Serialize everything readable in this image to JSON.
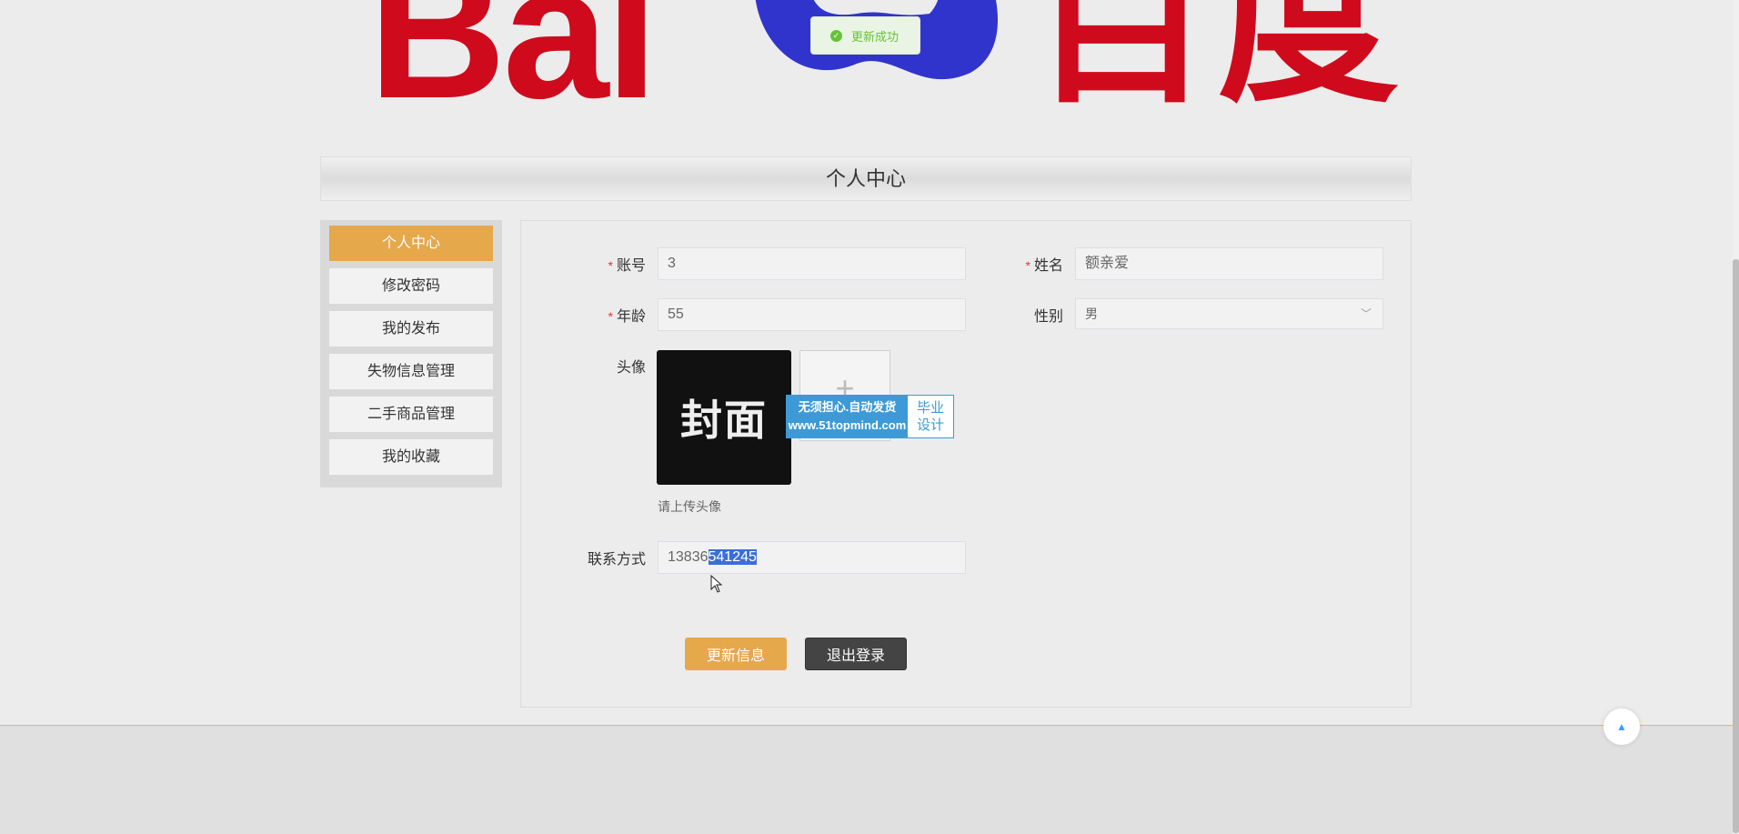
{
  "logo": {
    "latin": "Bai",
    "cn": "百度"
  },
  "toast": {
    "icon": "check-circle-icon",
    "text": "更新成功",
    "color": "#67c23a"
  },
  "page_title": "个人中心",
  "sidebar": {
    "accent": "#e5a84b",
    "items": [
      {
        "label": "个人中心",
        "active": true
      },
      {
        "label": "修改密码"
      },
      {
        "label": "我的发布"
      },
      {
        "label": "失物信息管理"
      },
      {
        "label": "二手商品管理"
      },
      {
        "label": "我的收藏"
      }
    ]
  },
  "form": {
    "account_label": "账号",
    "account_value": "3",
    "name_label": "姓名",
    "name_value": "额亲爱",
    "age_label": "年龄",
    "age_value": "55",
    "gender_label": "性别",
    "gender_value": "男",
    "avatar_label": "头像",
    "avatar_image_text": "封面",
    "upload_icon": "plus-icon",
    "avatar_hint": "请上传头像",
    "contact_label": "联系方式",
    "contact_prefix": "13836",
    "contact_selected": "541245",
    "required_mark": "*"
  },
  "watermark": {
    "line1": "无须担心.自动发货",
    "line2": "www.51topmind.com",
    "side1": "毕业",
    "side2": "设计"
  },
  "buttons": {
    "update": "更新信息",
    "update_color": "#e5a84b",
    "logout": "退出登录",
    "logout_color": "#444444"
  },
  "back_top_icon": "caret-up-icon"
}
